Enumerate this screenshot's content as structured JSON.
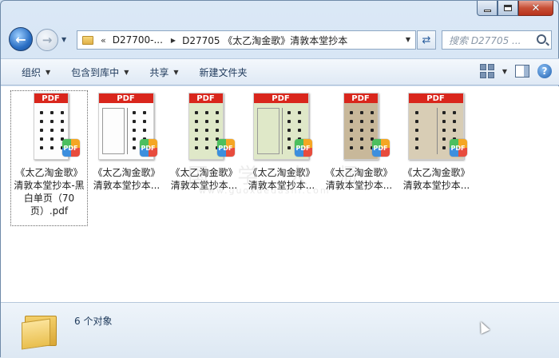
{
  "window": {
    "caption_buttons": {
      "minimize": "minimize-icon",
      "maximize": "maximize-icon",
      "close": "close-icon"
    }
  },
  "nav": {
    "back": "←",
    "forward": "→",
    "address_segments": [
      "D27700-...",
      "D27705 《太乙淘金歌》清敦本堂抄本"
    ],
    "address_prefix": "«",
    "search_placeholder": "搜索 D27705 ..."
  },
  "toolbar": {
    "organize": "组织",
    "include_in_library": "包含到库中",
    "share": "共享",
    "new_folder": "新建文件夹"
  },
  "files": [
    {
      "name": "《太乙淘金歌》清敦本堂抄本-黑白单页（70页）.pdf",
      "badge": "PDF",
      "selected": true
    },
    {
      "name": "《太乙淘金歌》清敦本堂抄本...",
      "badge": "PDF",
      "selected": false
    },
    {
      "name": "《太乙淘金歌》清敦本堂抄本...",
      "badge": "PDF",
      "selected": false
    },
    {
      "name": "《太乙淘金歌》清敦本堂抄本...",
      "badge": "PDF",
      "selected": false
    },
    {
      "name": "《太乙淘金歌》清敦本堂抄本...",
      "badge": "PDF",
      "selected": false
    },
    {
      "name": "《太乙淘金歌》清敦本堂抄本...",
      "badge": "PDF",
      "selected": false
    }
  ],
  "watermark": {
    "main": "国 学 大 师",
    "url": "www.guoxuedashi.com"
  },
  "status": {
    "text": "6 个对象"
  },
  "colors": {
    "pdf_red": "#d9261c",
    "toolbar_text": "#1e395b",
    "close_red": "#c74f36"
  }
}
